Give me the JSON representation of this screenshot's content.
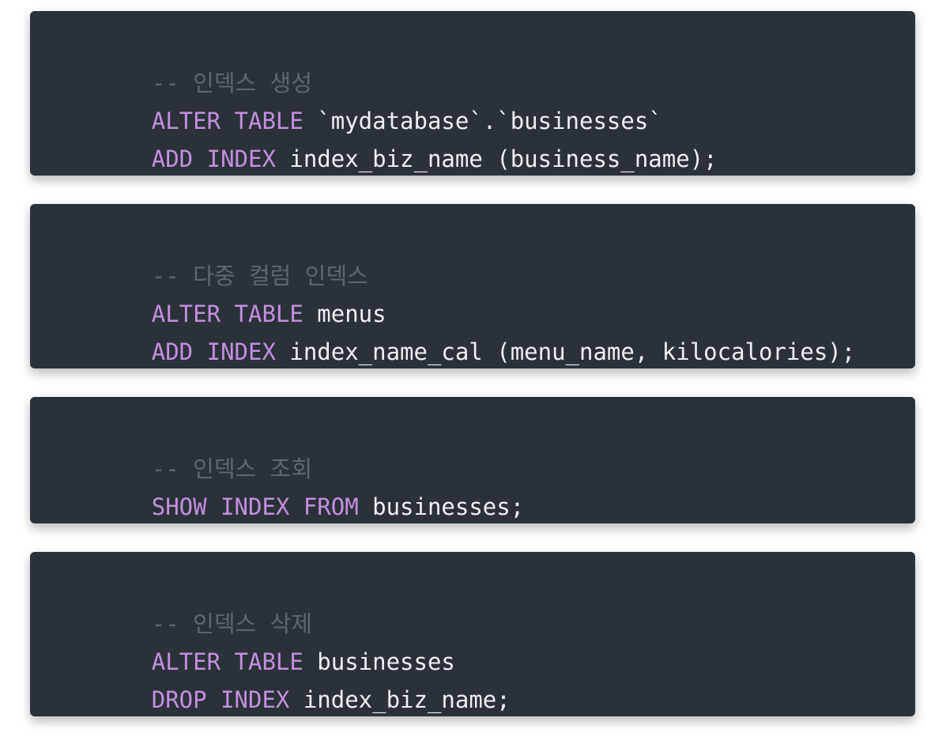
{
  "theme": {
    "block_background": "#2a3139",
    "keyword_color": "#c48fe0",
    "comment_color": "#5c6773",
    "text_color": "#eef0f3"
  },
  "blocks": [
    {
      "lines": [
        [
          {
            "type": "comment",
            "text": "-- 인덱스 생성"
          }
        ],
        [
          {
            "type": "kw",
            "text": "ALTER TABLE"
          },
          {
            "type": "plain",
            "text": " `mydatabase`.`businesses`"
          }
        ],
        [
          {
            "type": "kw",
            "text": "ADD INDEX"
          },
          {
            "type": "plain",
            "text": " index_biz_name (business_name);"
          }
        ]
      ]
    },
    {
      "lines": [
        [
          {
            "type": "comment",
            "text": "-- 다중 컬럼 인덱스"
          }
        ],
        [
          {
            "type": "kw",
            "text": "ALTER TABLE"
          },
          {
            "type": "plain",
            "text": " menus"
          }
        ],
        [
          {
            "type": "kw",
            "text": "ADD INDEX"
          },
          {
            "type": "plain",
            "text": " index_name_cal (menu_name, kilocalories);"
          }
        ]
      ]
    },
    {
      "lines": [
        [
          {
            "type": "comment",
            "text": "-- 인덱스 조회"
          }
        ],
        [
          {
            "type": "kw",
            "text": "SHOW INDEX FROM"
          },
          {
            "type": "plain",
            "text": " businesses;"
          }
        ]
      ]
    },
    {
      "lines": [
        [
          {
            "type": "comment",
            "text": "-- 인덱스 삭제"
          }
        ],
        [
          {
            "type": "kw",
            "text": "ALTER TABLE"
          },
          {
            "type": "plain",
            "text": " businesses"
          }
        ],
        [
          {
            "type": "kw",
            "text": "DROP INDEX"
          },
          {
            "type": "plain",
            "text": " index_biz_name;"
          }
        ]
      ]
    }
  ]
}
